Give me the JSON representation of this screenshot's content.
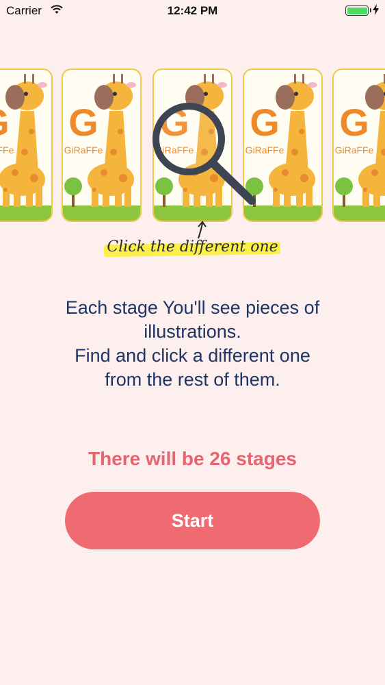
{
  "status_bar": {
    "carrier": "Carrier",
    "time": "12:42 PM",
    "wifi_icon": "wifi-icon",
    "battery_icon": "battery-icon",
    "charging_icon": "charging-bolt-icon"
  },
  "cards": {
    "letter": "G",
    "label": "GiRaFFe"
  },
  "hint": {
    "text": "Click the different one"
  },
  "instructions": {
    "line1": "Each stage You'll see pieces of",
    "line2": "illustrations.",
    "line3": "Find and click a different one",
    "line4": "from the rest of them."
  },
  "stages": {
    "text": "There will be 26 stages"
  },
  "start_button": {
    "label": "Start"
  },
  "colors": {
    "background": "#fdefed",
    "accent": "#f06a72",
    "text_dark": "#1e3566",
    "giraffe": "#f5b53d",
    "card_border": "#eec94a"
  }
}
